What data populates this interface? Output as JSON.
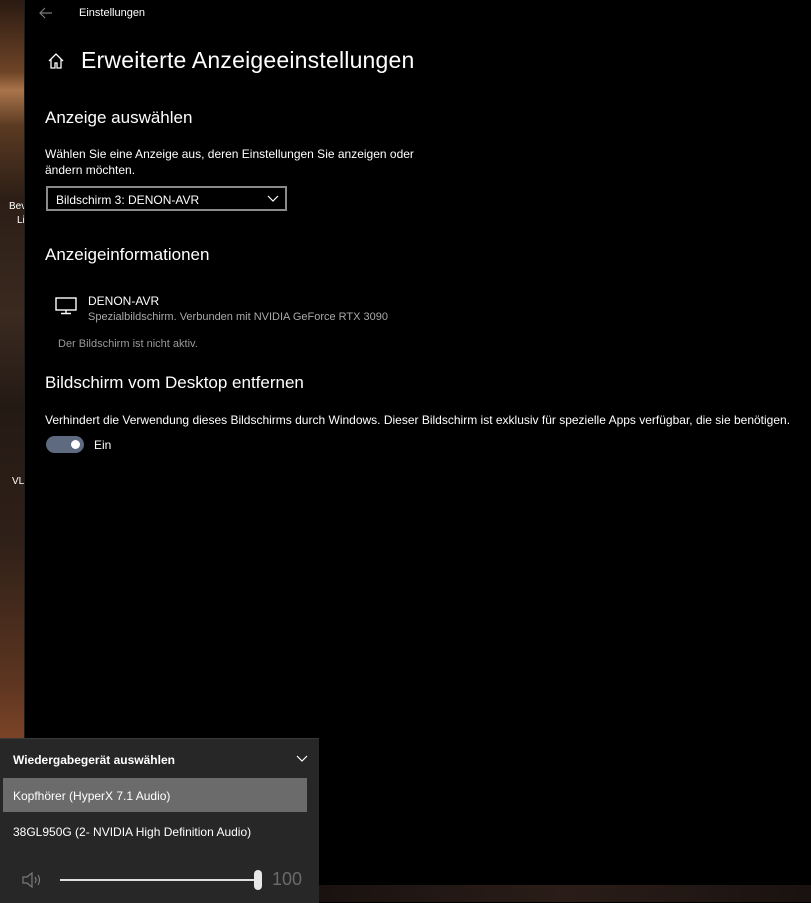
{
  "desktop": {
    "labels": [
      "Bev",
      "Li",
      "VL"
    ]
  },
  "window": {
    "title": "Einstellungen"
  },
  "page": {
    "title": "Erweiterte Anzeigeeinstellungen"
  },
  "select_display": {
    "heading": "Anzeige auswählen",
    "desc_line1": "Wählen Sie eine Anzeige aus, deren Einstellungen Sie anzeigen oder",
    "desc_line2": "ändern möchten.",
    "selected": "Bildschirm 3: DENON-AVR"
  },
  "display_info": {
    "heading": "Anzeigeinformationen",
    "name": "DENON-AVR",
    "subtitle": "Spezialbildschirm. Verbunden mit NVIDIA GeForce RTX 3090",
    "inactive": "Der Bildschirm ist nicht aktiv."
  },
  "remove_desktop": {
    "heading": "Bildschirm vom Desktop entfernen",
    "desc": "Verhindert die Verwendung dieses Bildschirms durch Windows. Dieser Bildschirm ist exklusiv für spezielle Apps verfügbar, die sie benötigen.",
    "toggle_label": "Ein",
    "toggle_on": true
  },
  "audio_flyout": {
    "title": "Wiedergabegerät auswählen",
    "devices": [
      {
        "label": "Kopfhörer (HyperX 7.1 Audio)",
        "selected": true
      },
      {
        "label": "38GL950G (2- NVIDIA High Definition Audio)",
        "selected": false
      }
    ],
    "volume": "100"
  },
  "colors": {
    "accent_toggle": "#5e6a80",
    "flyout_bg": "#272727",
    "selected_bg": "#6b6b6b"
  }
}
